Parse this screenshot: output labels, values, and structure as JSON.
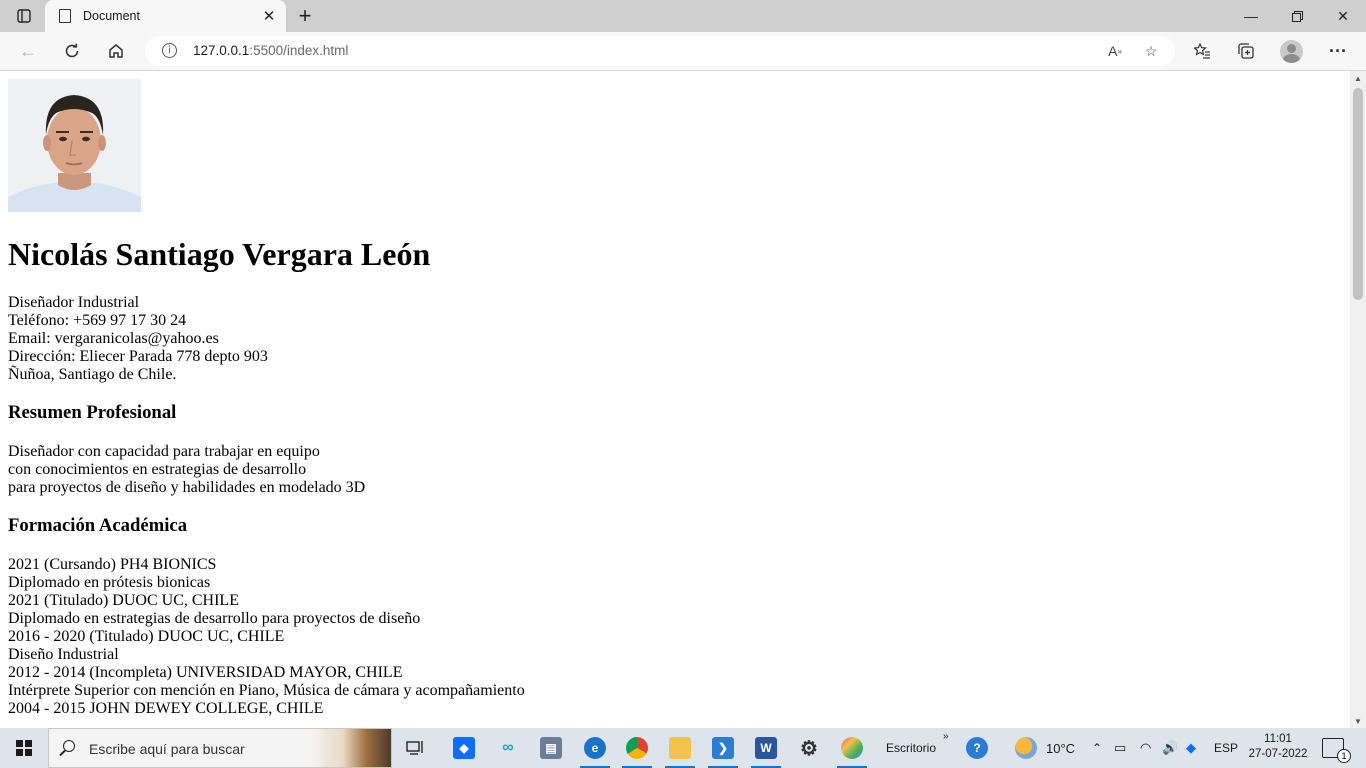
{
  "browser": {
    "tab_title": "Document",
    "url_host": "127.0.0.1",
    "url_rest": ":5500/index.html"
  },
  "page": {
    "photo_alt": "Foto de perfil",
    "name": "Nicolás Santiago Vergara León",
    "contact": [
      "Diseñador Industrial",
      "Teléfono: +569 97 17 30 24",
      "Email: vergaranicolas@yahoo.es",
      "Dirección: Eliecer Parada 778 depto 903",
      "Ñuñoa, Santiago de Chile."
    ],
    "summary_title": "Resumen Profesional",
    "summary": [
      "Diseñador con capacidad para trabajar en equipo",
      "con conocimientos en estrategias de desarrollo",
      "para proyectos de diseño y habilidades en modelado 3D"
    ],
    "education_title": "Formación Académica",
    "education": [
      "2021 (Cursando) PH4 BIONICS",
      "Diplomado en prótesis bionicas",
      "2021 (Titulado) DUOC UC, CHILE",
      "Diplomado en estrategias de desarrollo para proyectos de diseño",
      "2016 - 2020 (Titulado) DUOC UC, CHILE",
      "Diseño Industrial",
      "2012 - 2014 (Incompleta) UNIVERSIDAD MAYOR, CHILE",
      "Intérprete Superior con mención en Piano, Música de cámara y acompañamiento",
      "2004 - 2015 JOHN DEWEY COLLEGE, CHILE"
    ]
  },
  "taskbar": {
    "search_placeholder": "Escribe aquí para buscar",
    "desktop_label": "Escritorio",
    "weather": "10°C",
    "language": "ESP",
    "time": "11:01",
    "date": "27-07-2022",
    "notification_count": "1"
  },
  "colors": {
    "edge_blue": "#1a73c9",
    "vscode_blue": "#2b7cd3",
    "word_blue": "#2b579a"
  }
}
